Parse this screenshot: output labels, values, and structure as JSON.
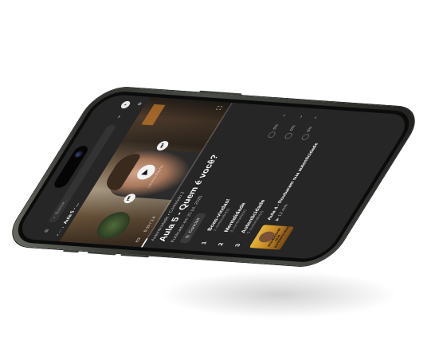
{
  "header": {
    "search_placeholder": "Buscar...",
    "menu_glyph": "›",
    "back_glyph": "‹",
    "nav_glyph": "≡",
    "search_icon": "search-icon"
  },
  "breadcrumb": {
    "ellipsis": "• ⋯ ›",
    "current": "Aula 5 - ...",
    "settings_icon": "gear-icon"
  },
  "video": {
    "time": "0:19 / 1:4",
    "watermark": "Oliveira Rocha",
    "progress_fraction": 0.06,
    "play_icon": "play-icon",
    "prev_icon": "skip-previous-icon",
    "next_icon": "skip-next-icon"
  },
  "lesson": {
    "meta": "Autenticidade • Conteúdo 2",
    "title": "Aula 5 - Quem é você?",
    "published": "Publicado em 31 jul. 2025",
    "complete_label": "Concluir"
  },
  "modules": [
    {
      "num": "1",
      "title": "Boas-vindas!",
      "sub": "1 conteúdo(s)",
      "pct": "0%",
      "chev": "⌄"
    },
    {
      "num": "2",
      "title": "Mentalidade",
      "sub": "3 conteúdo(s)",
      "pct": "0%",
      "chev": "⌄"
    },
    {
      "num": "3",
      "title": "Autenticidade",
      "sub": "5 conteúdo(s)",
      "pct": "0%",
      "chev": "⌃"
    }
  ],
  "module_lesson": {
    "title": "Aula 4 - Roubaram sua autenticidade",
    "duration": "12 min",
    "thumb_text": "ROUBARAM SUA AUTENTICIDADE"
  },
  "colors": {
    "screen_bg": "#262626",
    "text_primary": "#ffffff",
    "text_secondary": "#bdbdbd",
    "thumb_accent": "#e4b53a"
  }
}
